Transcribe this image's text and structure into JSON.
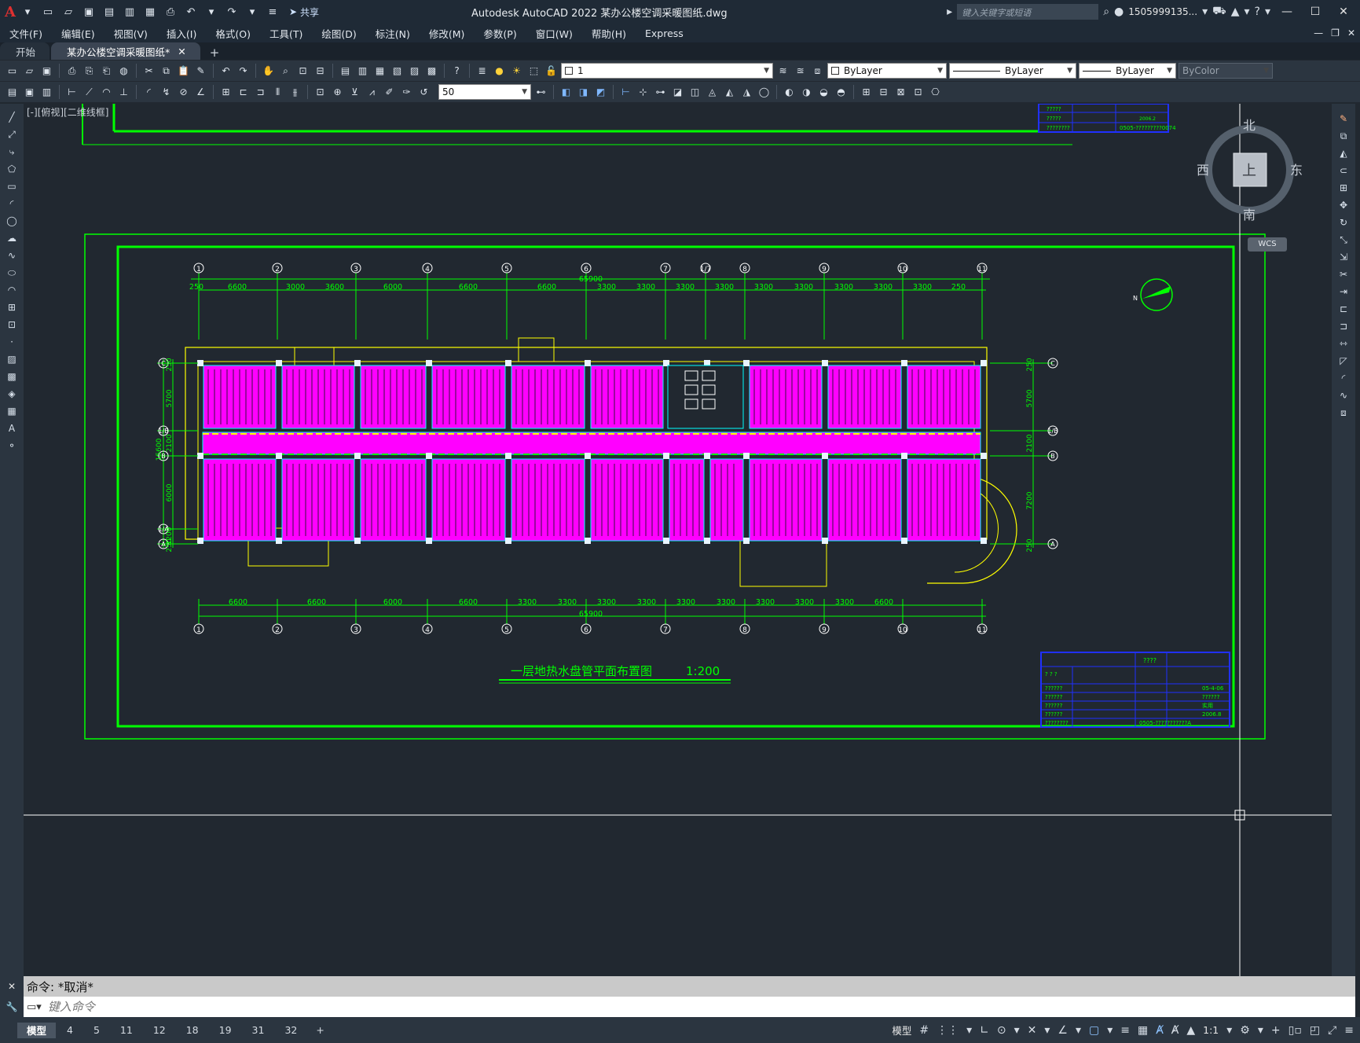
{
  "app": {
    "title": "Autodesk AutoCAD 2022    某办公楼空调采暖图纸.dwg",
    "share_label": "共享",
    "search_placeholder": "键入关键字或短语",
    "user": "1505999135...",
    "accent": "#e03030"
  },
  "menus": [
    "文件(F)",
    "编辑(E)",
    "视图(V)",
    "插入(I)",
    "格式(O)",
    "工具(T)",
    "绘图(D)",
    "标注(N)",
    "修改(M)",
    "参数(P)",
    "窗口(W)",
    "帮助(H)",
    "Express"
  ],
  "tabs": [
    {
      "label": "开始",
      "active": false
    },
    {
      "label": "某办公楼空调采暖图纸*",
      "active": true
    }
  ],
  "toolbar": {
    "layer_value": "1",
    "color_value": "ByLayer",
    "linetype_value": "ByLayer",
    "lineweight_value": "ByLayer",
    "plotstyle_value": "ByColor",
    "scale_value": "50"
  },
  "viewport": {
    "label": "[-][俯视][二维线框]",
    "viewcube": {
      "north": "北",
      "south": "南",
      "east": "东",
      "west": "西",
      "face": "上",
      "wcs": "WCS"
    }
  },
  "drawing": {
    "plan_title": "一层地热水盘管平面布置图",
    "scale_note": "1:200",
    "overall_dim": "65900",
    "top_dims": [
      "250",
      "6600",
      "3000",
      "3600",
      "6000",
      "6600",
      "6600",
      "3300",
      "3300",
      "3300",
      "3300",
      "3300",
      "3300",
      "3300",
      "3300",
      "3300",
      "250"
    ],
    "bottom_dims": [
      "6600",
      "6600",
      "6000",
      "6600",
      "3300",
      "3300",
      "3300",
      "3300",
      "3300",
      "3300",
      "3300",
      "3300",
      "3300",
      "6600"
    ],
    "top_axes": [
      "1",
      "2",
      "3",
      "4",
      "5",
      "6",
      "7",
      "1/7",
      "8",
      "9",
      "10",
      "11"
    ],
    "bottom_axes": [
      "1",
      "2",
      "3",
      "4",
      "5",
      "6",
      "7",
      "8",
      "9",
      "10",
      "11"
    ],
    "left_axes": [
      "C",
      "1/B",
      "B",
      "1/A",
      "A"
    ],
    "left_dims": [
      "250",
      "5700",
      "2100",
      "6000",
      "1200",
      "250",
      "15600"
    ],
    "right_axes": [
      "C",
      "1/B",
      "B",
      "A"
    ],
    "right_dims": [
      "250",
      "5700",
      "2100",
      "7200",
      "250"
    ],
    "north_label": "N",
    "title_block": {
      "header": "????",
      "rows": [
        "?  ?  ?",
        "??????",
        "??????",
        "??????",
        "??????",
        "????????"
      ],
      "right_rows": [
        "05-4-06",
        "??????",
        "实用",
        "2006.8"
      ],
      "codes": "0505-???????????A",
      "top_code": "0505-?????????0074",
      "top_date": "2006.2"
    }
  },
  "command": {
    "history": "命令:  *取消*",
    "placeholder": "键入命令"
  },
  "layouts": [
    {
      "label": "模型",
      "active": true
    },
    {
      "label": "4"
    },
    {
      "label": "5"
    },
    {
      "label": "11"
    },
    {
      "label": "12"
    },
    {
      "label": "18"
    },
    {
      "label": "19"
    },
    {
      "label": "31"
    },
    {
      "label": "32"
    }
  ],
  "status": {
    "model_label": "模型",
    "annotation_scale": "1:1"
  },
  "colors": {
    "frame_green": "#00ff00",
    "wall_yellow": "#ffff00",
    "coil_magenta": "#ff00ff",
    "block_blue": "#2030ff",
    "cyan": "#00ffff"
  }
}
